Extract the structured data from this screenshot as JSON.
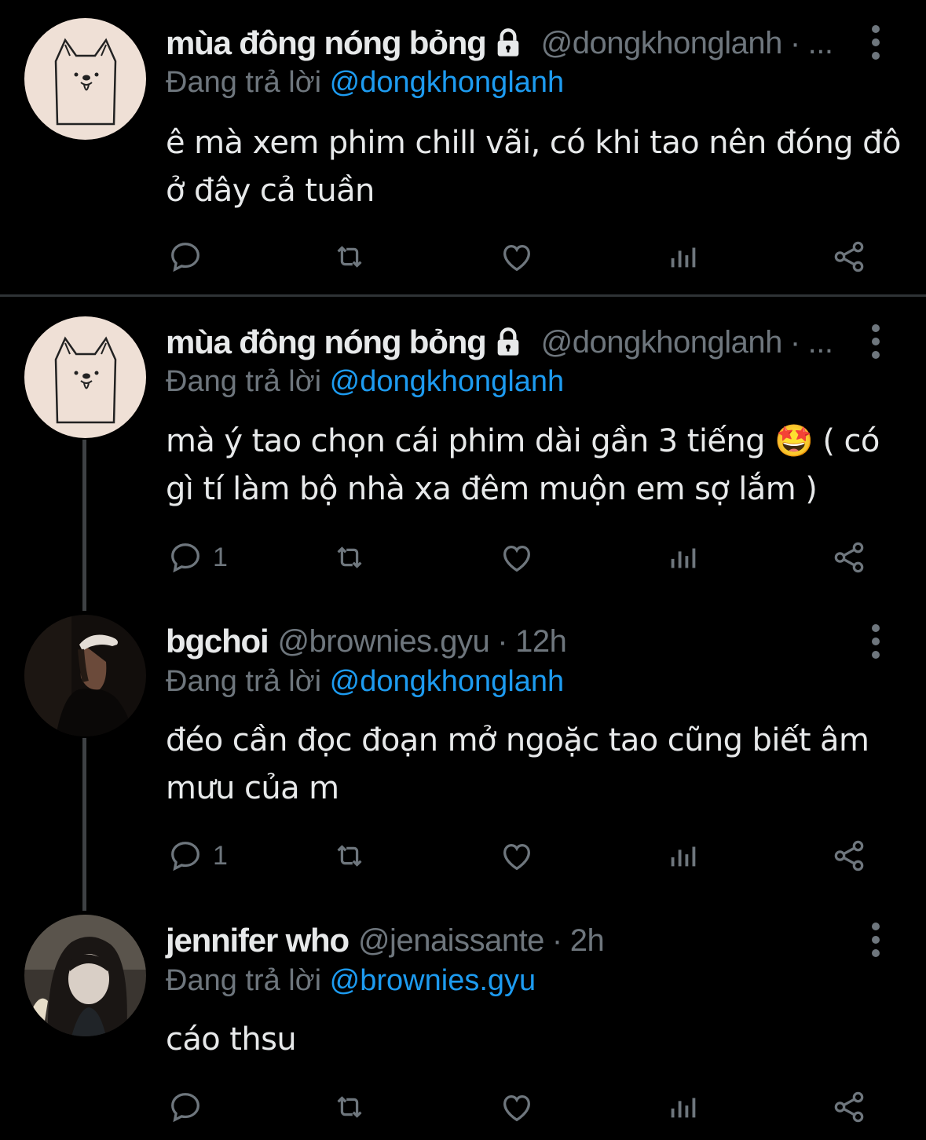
{
  "theme": {
    "background": "#000000",
    "text": "#e7e9ea",
    "secondary": "#6e767d",
    "accent": "#1d9bf0"
  },
  "tweets": [
    {
      "author_name": "mùa đông nóng bỏng",
      "locked": true,
      "handle": "@dongkhonglanh",
      "separator": "·",
      "time": "...",
      "reply_prefix": "Đang trả lời",
      "reply_to": "@dongkhonglanh",
      "text_line1": "ê mà xem phim chill vãi, có khi tao nên đóng đô",
      "text_line2": "ở đây cả tuần",
      "reply_count": "",
      "avatar": "dog-sketch-avatar"
    },
    {
      "author_name": "mùa đông nóng bỏng",
      "locked": true,
      "handle": "@dongkhonglanh",
      "separator": "·",
      "time": "...",
      "reply_prefix": "Đang trả lời",
      "reply_to": "@dongkhonglanh",
      "text_line1": "mà ý tao chọn cái phim dài gần 3 tiếng 🤩 ( có",
      "text_line2": "gì tí làm bộ nhà xa đêm muộn em sợ lắm )",
      "reply_count": "1",
      "avatar": "dog-sketch-avatar"
    },
    {
      "author_name": "bgchoi",
      "locked": false,
      "handle": "@brownies.gyu",
      "separator": "·",
      "time": "12h",
      "reply_prefix": "Đang trả lời",
      "reply_to": "@dongkhonglanh",
      "text_line1": "đéo cần đọc đoạn mở ngoặc tao cũng biết âm",
      "text_line2": "mưu của m",
      "reply_count": "1",
      "avatar": "photo-avatar-cap"
    },
    {
      "author_name": "jennifer who",
      "locked": false,
      "handle": "@jenaissante",
      "separator": "·",
      "time": "2h",
      "reply_prefix": "Đang trả lời",
      "reply_to": "@brownies.gyu",
      "text_line1": "cáo thsu",
      "text_line2": "",
      "reply_count": "",
      "avatar": "photo-avatar-girl"
    }
  ],
  "icons": [
    "lock-icon",
    "more-options-icon",
    "reply-icon",
    "retweet-icon",
    "like-icon",
    "analytics-icon",
    "share-icon"
  ]
}
